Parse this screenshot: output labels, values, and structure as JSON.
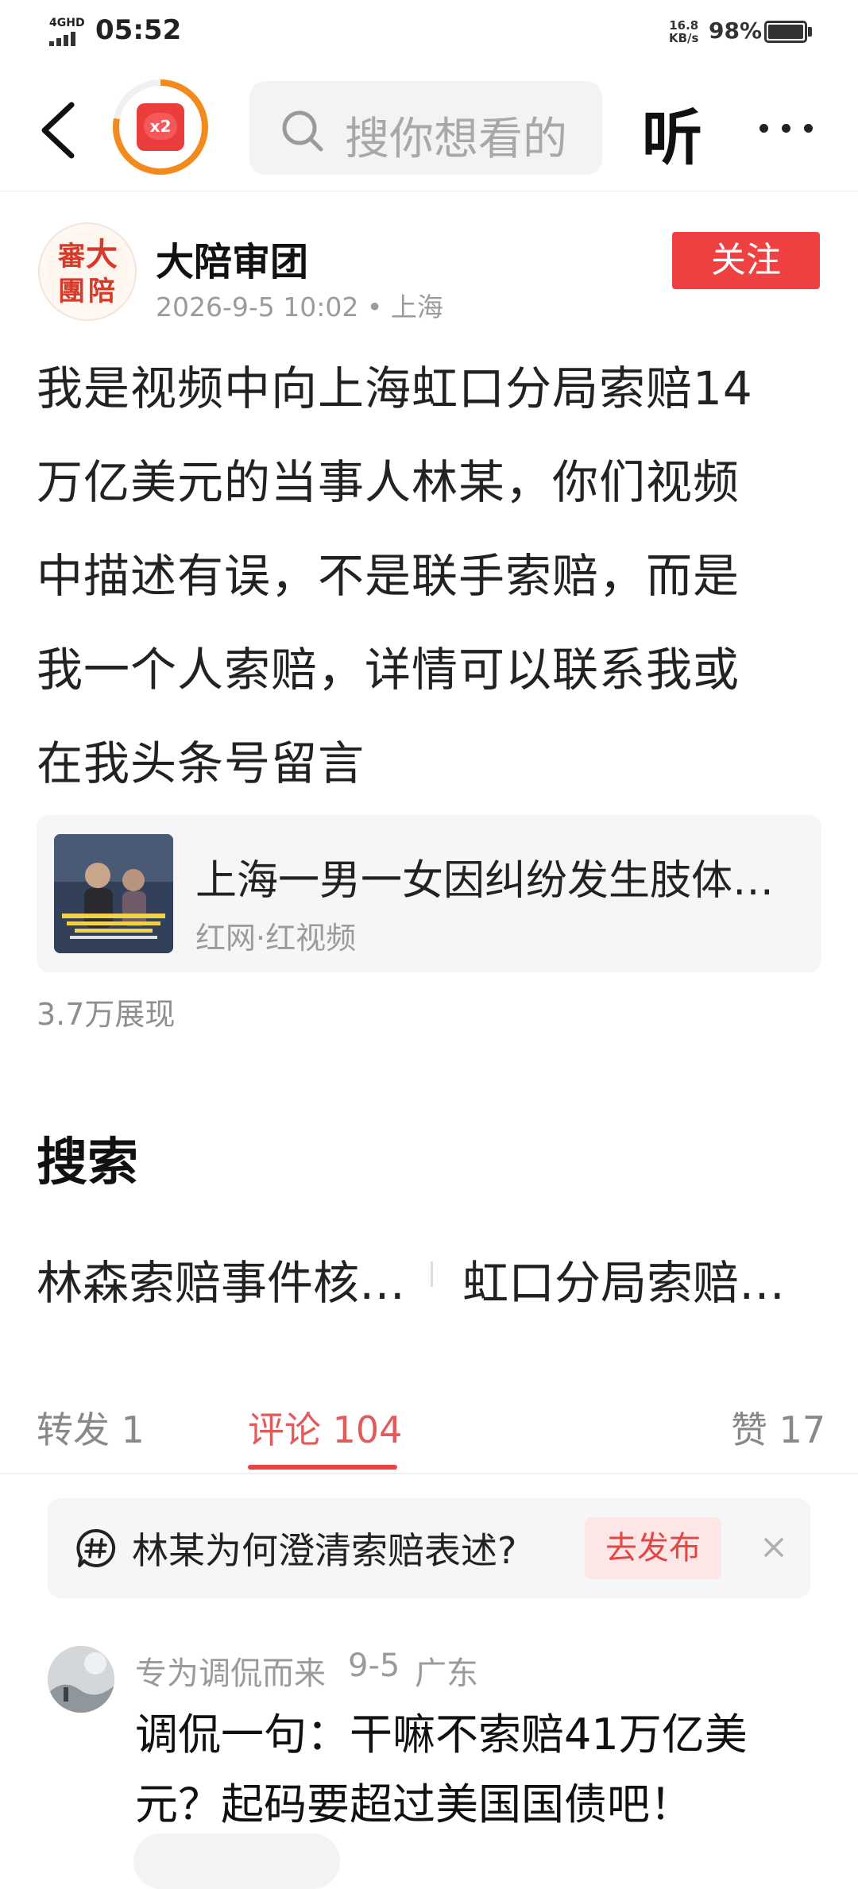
{
  "status_bar": {
    "network": "4GHD",
    "time": "05:52",
    "speed_value": "16.8",
    "speed_unit": "KB/s",
    "battery": "98%"
  },
  "header": {
    "badge_text": "x2",
    "search_placeholder": "搜你想看的",
    "listen_label": "听"
  },
  "post": {
    "author_name": "大陪审团",
    "avatar_chars": [
      "大",
      "審",
      "陪",
      "團"
    ],
    "date": "2026-9-5 10:02",
    "location": "上海",
    "follow_label": "关注",
    "body_lines": [
      "我是视频中向上海虹口分局索赔14",
      "万亿美元的当事人林某，你们视频",
      "中描述有误，不是联手索赔，而是",
      "我一个人索赔，详情可以联系我或",
      "在我头条号留言"
    ],
    "linked_video": {
      "title": "上海一男一女因纠纷发生肢体冲突",
      "source": "红网·红视频"
    },
    "views": "3.7万展现"
  },
  "search_section": {
    "heading": "搜索",
    "items": [
      "林森索赔事件核…",
      "虹口分局索赔…"
    ]
  },
  "tabs": {
    "repost": "转发 1",
    "comments": "评论 104",
    "likes": "赞 17"
  },
  "topic_banner": {
    "text": "林某为何澄清索赔表述?",
    "publish_label": "去发布"
  },
  "comment": {
    "user": "专为调侃而来",
    "date": "9-5",
    "location": "广东",
    "text_lines": [
      "调侃一句：干嘛不索赔41万亿美",
      "元？起码要超过美国国债吧！"
    ]
  },
  "colors": {
    "accent_red": "#f04142",
    "badge_orange": "#f28b1b",
    "muted_text": "#9b9b9b"
  }
}
